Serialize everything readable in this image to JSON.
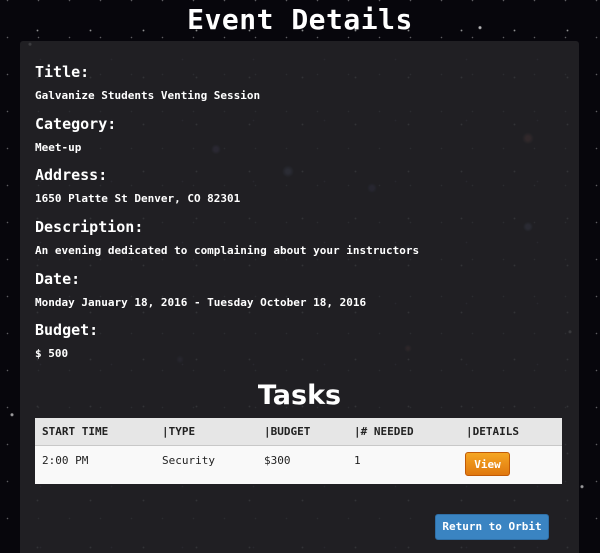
{
  "page": {
    "title": "Event Details"
  },
  "event": {
    "title_label": "Title:",
    "title_value": "Galvanize Students Venting Session",
    "category_label": "Category:",
    "category_value": "Meet-up",
    "address_label": "Address:",
    "address_value": "1650 Platte St Denver, CO 82301",
    "description_label": "Description:",
    "description_value": "An evening dedicated to complaining about your instructors",
    "date_label": "Date:",
    "date_value": "Monday January 18, 2016 - Tuesday October 18, 2016",
    "budget_label": "Budget:",
    "budget_value": "$ 500"
  },
  "tasks": {
    "heading": "Tasks",
    "columns": [
      "START TIME",
      "|TYPE",
      "|BUDGET",
      "|# NEEDED",
      "|DETAILS"
    ],
    "rows": [
      {
        "start_time": "2:00 PM",
        "type": "Security",
        "budget": "$300",
        "needed": "1",
        "details_button": "View"
      }
    ]
  },
  "actions": {
    "return_label": "Return to Orbit"
  },
  "colors": {
    "panel": "#242428",
    "view_button": "#e0780f",
    "return_button": "#3a84c2"
  }
}
